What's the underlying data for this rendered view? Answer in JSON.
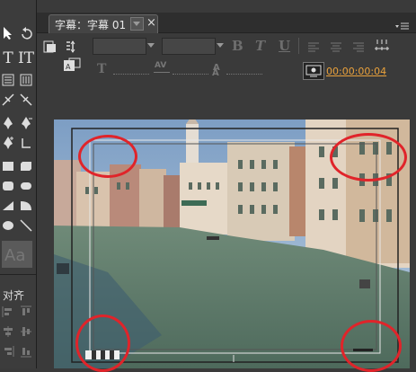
{
  "tab": {
    "title": "字幕：字幕 01",
    "close": "×"
  },
  "panel_menu_icon": "panel-menu-icon",
  "text_controls": {
    "bold": "B",
    "italic": "T",
    "underline": "U",
    "size_icon": "T",
    "kerning": "AV",
    "leading_label": "A",
    "baseline_label": "A"
  },
  "timecode": "00:00:00:04",
  "align_panel_label": "对齐",
  "colors": {
    "timecode": "#e9a13c",
    "annotation": "#e0242a",
    "panel": "#3a3a3a"
  }
}
